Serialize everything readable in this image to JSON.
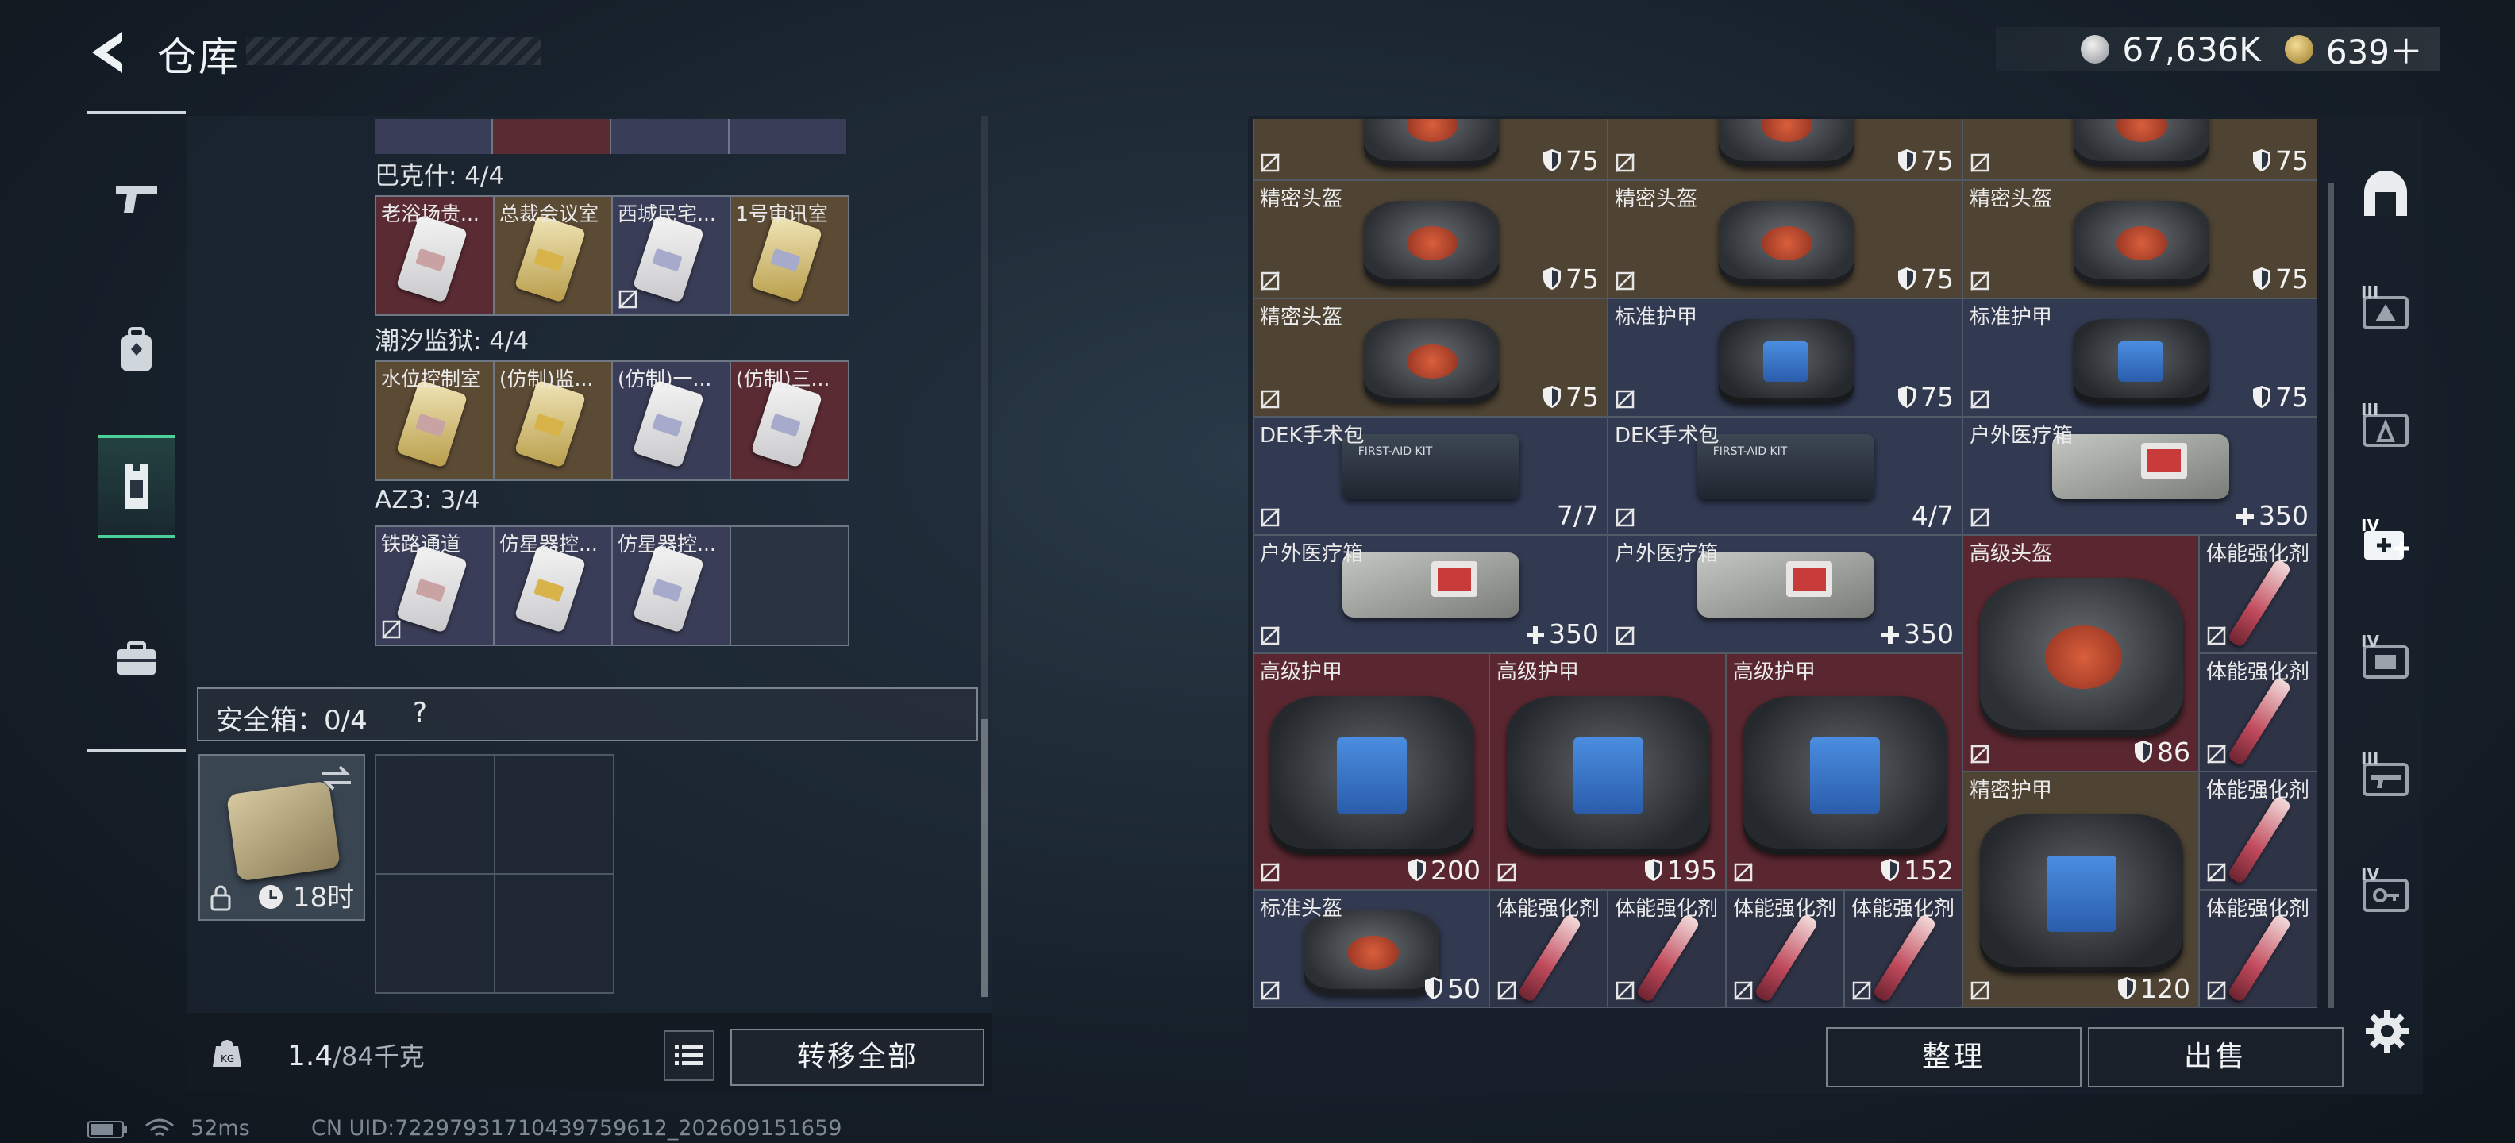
{
  "header": {
    "title": "仓库",
    "currencies": [
      {
        "icon": "silver-coin-icon",
        "value": "67,636K"
      },
      {
        "icon": "gold-coin-icon",
        "value": "639＋"
      }
    ]
  },
  "left_sidebar": {
    "items": [
      {
        "icon": "pistol-icon",
        "active": false
      },
      {
        "icon": "backpack-icon",
        "active": false
      },
      {
        "icon": "vest-icon",
        "active": true
      },
      {
        "icon": "briefcase-icon",
        "active": false
      }
    ]
  },
  "key_groups": [
    {
      "title": "巴克什: 4/4",
      "keys": [
        {
          "label": "老浴场贵...",
          "rarity": "red"
        },
        {
          "label": "总裁会议室",
          "rarity": "gold"
        },
        {
          "label": "西城民宅...",
          "rarity": "purple"
        },
        {
          "label": "1号审讯室",
          "rarity": "gold"
        }
      ]
    },
    {
      "title": "潮汐监狱: 4/4",
      "keys": [
        {
          "label": "水位控制室",
          "rarity": "gold"
        },
        {
          "label": "(仿制)监...",
          "rarity": "gold"
        },
        {
          "label": "(仿制)一...",
          "rarity": "purple"
        },
        {
          "label": "(仿制)三...",
          "rarity": "red"
        }
      ]
    },
    {
      "title": "AZ3: 3/4",
      "keys": [
        {
          "label": "铁路通道",
          "rarity": "purple"
        },
        {
          "label": "仿星器控...",
          "rarity": "purple"
        },
        {
          "label": "仿星器控...",
          "rarity": "purple"
        },
        {
          "label": "",
          "rarity": "empty"
        }
      ]
    }
  ],
  "safebox": {
    "label": "安全箱：0/4",
    "help": "?",
    "timer": "18时"
  },
  "bottom_left": {
    "weight": "1.4",
    "weight_max": "/84千克",
    "transfer_all": "转移全部"
  },
  "status": {
    "ping": "52ms",
    "uid": "CN UID:72297931710439759612_202609151659"
  },
  "stash_items": [
    {
      "name": "",
      "value": "75",
      "kind": "helmet",
      "rarity": "gold",
      "stat": "shield"
    },
    {
      "name": "",
      "value": "75",
      "kind": "helmet",
      "rarity": "gold",
      "stat": "shield"
    },
    {
      "name": "",
      "value": "75",
      "kind": "helmet",
      "rarity": "gold",
      "stat": "shield"
    },
    {
      "name": "精密头盔",
      "value": "75",
      "kind": "helmet",
      "rarity": "gold",
      "stat": "shield"
    },
    {
      "name": "精密头盔",
      "value": "75",
      "kind": "helmet",
      "rarity": "gold",
      "stat": "shield"
    },
    {
      "name": "精密头盔",
      "value": "75",
      "kind": "helmet",
      "rarity": "gold",
      "stat": "shield"
    },
    {
      "name": "精密头盔",
      "value": "75",
      "kind": "helmet",
      "rarity": "gold",
      "stat": "shield"
    },
    {
      "name": "标准护甲",
      "value": "75",
      "kind": "armor",
      "rarity": "purple",
      "stat": "shield"
    },
    {
      "name": "标准护甲",
      "value": "75",
      "kind": "armor",
      "rarity": "purple",
      "stat": "shield"
    },
    {
      "name": "DEK手术包",
      "value": "7/7",
      "kind": "medkit",
      "rarity": "purple",
      "stat": "none"
    },
    {
      "name": "DEK手术包",
      "value": "4/7",
      "kind": "medkit",
      "rarity": "purple",
      "stat": "none"
    },
    {
      "name": "户外医疗箱",
      "value": "350",
      "kind": "outdoor",
      "rarity": "purple",
      "stat": "plus"
    },
    {
      "name": "户外医疗箱",
      "value": "350",
      "kind": "outdoor",
      "rarity": "purple",
      "stat": "plus"
    },
    {
      "name": "户外医疗箱",
      "value": "350",
      "kind": "outdoor",
      "rarity": "purple",
      "stat": "plus"
    },
    {
      "name": "高级头盔",
      "value": "86",
      "kind": "helmet",
      "rarity": "red",
      "stat": "shield"
    },
    {
      "name": "体能强化剂",
      "value": "",
      "kind": "syringe",
      "rarity": "darkpurple",
      "stat": "none"
    },
    {
      "name": "高级护甲",
      "value": "200",
      "kind": "armor",
      "rarity": "red",
      "stat": "shield"
    },
    {
      "name": "高级护甲",
      "value": "195",
      "kind": "armor",
      "rarity": "red",
      "stat": "shield"
    },
    {
      "name": "高级护甲",
      "value": "152",
      "kind": "armor",
      "rarity": "red",
      "stat": "shield"
    },
    {
      "name": "体能强化剂",
      "value": "",
      "kind": "syringe",
      "rarity": "darkpurple",
      "stat": "none"
    },
    {
      "name": "精密护甲",
      "value": "120",
      "kind": "armor",
      "rarity": "gold",
      "stat": "shield"
    },
    {
      "name": "体能强化剂",
      "value": "",
      "kind": "syringe",
      "rarity": "darkpurple",
      "stat": "none"
    },
    {
      "name": "标准头盔",
      "value": "50",
      "kind": "helmet",
      "rarity": "purple",
      "stat": "shield"
    },
    {
      "name": "体能强化剂",
      "value": "",
      "kind": "syringe",
      "rarity": "darkpurple",
      "stat": "none"
    },
    {
      "name": "体能强化剂",
      "value": "",
      "kind": "syringe",
      "rarity": "darkpurple",
      "stat": "none"
    },
    {
      "name": "体能强化剂",
      "value": "",
      "kind": "syringe",
      "rarity": "darkpurple",
      "stat": "none"
    },
    {
      "name": "体能强化剂",
      "value": "",
      "kind": "syringe",
      "rarity": "darkpurple",
      "stat": "none"
    },
    {
      "name": "体能强化剂",
      "value": "",
      "kind": "syringe",
      "rarity": "darkpurple",
      "stat": "none"
    }
  ],
  "actions": {
    "sort": "整理",
    "sell": "出售"
  },
  "right_sidebar": {
    "items": [
      {
        "icon": "all-items-icon",
        "tier": ""
      },
      {
        "icon": "helmet-tier-icon",
        "tier": "III"
      },
      {
        "icon": "armor-tier-icon",
        "tier": "III"
      },
      {
        "icon": "medkit-tier-icon",
        "tier": "IV"
      },
      {
        "icon": "ammo-tier-icon",
        "tier": "IV"
      },
      {
        "icon": "weapon-tier-icon",
        "tier": "III"
      },
      {
        "icon": "key-tier-icon",
        "tier": "IV"
      }
    ],
    "settings_icon": "gear-icon"
  },
  "colors": {
    "accent": "#4bd09a",
    "rarity_gold": "#4f4433",
    "rarity_purple": "#323a52",
    "rarity_red": "#5a2730"
  }
}
